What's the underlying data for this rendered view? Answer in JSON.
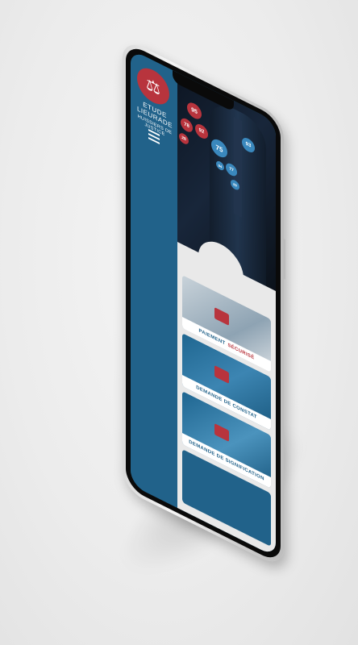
{
  "brand": {
    "logo_icon": "scales-of-justice-icon",
    "name": "ETUDE LIEURADE",
    "tagline": "HUISSIERS DE JUSTICE"
  },
  "menu_icon": "hamburger-menu-icon",
  "map_bubbles": [
    {
      "label": "95",
      "color": "#b8343d"
    },
    {
      "label": "78",
      "color": "#b8343d"
    },
    {
      "label": "92",
      "color": "#b8343d"
    },
    {
      "label": "28",
      "color": "#b8343d"
    },
    {
      "label": "75",
      "color": "#3a88bd"
    },
    {
      "label": "93",
      "color": "#3a88bd"
    },
    {
      "label": "94",
      "color": "#3a88bd"
    },
    {
      "label": "77",
      "color": "#3a88bd"
    },
    {
      "label": "89",
      "color": "#3a88bd"
    }
  ],
  "cards": [
    {
      "label": "PAIEMENT",
      "label_accent": "SÉCURISÉ"
    },
    {
      "label": "DEMANDE DE CONSTAT",
      "label_accent": ""
    },
    {
      "label": "DEMANDE DE SIGNIFICATION",
      "label_accent": ""
    }
  ],
  "colors": {
    "primary_blue": "#21628a",
    "accent_red": "#b8343d",
    "light_blue": "#3a88bd"
  }
}
